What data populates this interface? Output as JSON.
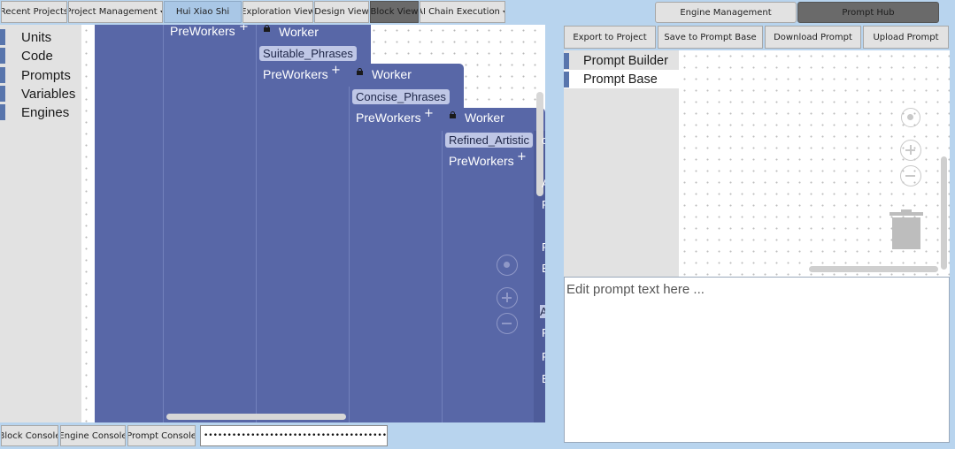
{
  "top_toolbar": {
    "recent_projects": "Recent Projects",
    "project_management": "Project Management",
    "project_name": "Hui Xiao Shi",
    "exploration_view": "Exploration View",
    "design_view": "Design View",
    "block_view": "Block View",
    "ai_chain_execution": "AI Chain Execution"
  },
  "sidebar": {
    "items": [
      {
        "label": "Units"
      },
      {
        "label": "Code"
      },
      {
        "label": "Prompts"
      },
      {
        "label": "Variables"
      },
      {
        "label": "Engines"
      }
    ]
  },
  "blocks": [
    {
      "preworkers": "PreWorkers",
      "worker": "Worker",
      "chip": "Suitable_Phrases"
    },
    {
      "preworkers": "PreWorkers",
      "worker": "Worker",
      "chip": "Concise_Phrases"
    },
    {
      "preworkers": "PreWorkers",
      "worker": "Worker",
      "chip": "Refined_Artistic"
    },
    {
      "preworkers": "PreWorkers"
    }
  ],
  "truncated_labels": [
    "c",
    "A",
    "P",
    "F",
    "E",
    "A",
    "F",
    "F",
    "E"
  ],
  "consoles": {
    "block_console": "Block Console",
    "engine_console": "Engine Console",
    "prompt_console": "Prompt Console",
    "password_value": "••••••••••••••••••••••••••••••••••••••••••"
  },
  "right_tabs": {
    "engine_management": "Engine Management",
    "prompt_hub": "Prompt Hub"
  },
  "prompt_actions": {
    "export": "Export to Project",
    "save": "Save to Prompt Base",
    "download": "Download Prompt",
    "upload": "Upload Prompt"
  },
  "prompt_hub_sidebar": {
    "items": [
      {
        "label": "Prompt Builder"
      },
      {
        "label": "Prompt Base"
      }
    ]
  },
  "prompt_editor": {
    "placeholder": "Edit prompt text here ..."
  },
  "colors": {
    "block_fill": "#5867a7",
    "toolbar_blue": "#a9c7e6",
    "active_tab": "#6a6a6a",
    "sidebar_marker": "#5875ac",
    "window_bg": "#b8d4ee"
  },
  "icons": [
    "lock-icon",
    "plus-icon",
    "locate-icon",
    "zoom-in-icon",
    "zoom-out-icon",
    "trash-icon",
    "caret-down-icon"
  ]
}
